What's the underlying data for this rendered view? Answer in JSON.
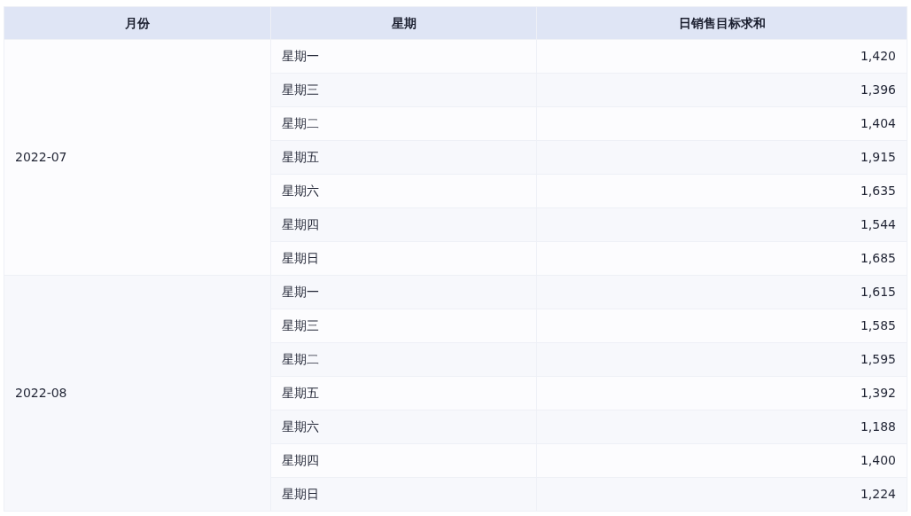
{
  "table": {
    "columns": [
      "月份",
      "星期",
      "日销售目标求和"
    ],
    "groups": [
      {
        "month": "2022-07",
        "rows": [
          {
            "weekday": "星期一",
            "value": "1,420"
          },
          {
            "weekday": "星期三",
            "value": "1,396"
          },
          {
            "weekday": "星期二",
            "value": "1,404"
          },
          {
            "weekday": "星期五",
            "value": "1,915"
          },
          {
            "weekday": "星期六",
            "value": "1,635"
          },
          {
            "weekday": "星期四",
            "value": "1,544"
          },
          {
            "weekday": "星期日",
            "value": "1,685"
          }
        ]
      },
      {
        "month": "2022-08",
        "rows": [
          {
            "weekday": "星期一",
            "value": "1,615"
          },
          {
            "weekday": "星期三",
            "value": "1,585"
          },
          {
            "weekday": "星期二",
            "value": "1,595"
          },
          {
            "weekday": "星期五",
            "value": "1,392"
          },
          {
            "weekday": "星期六",
            "value": "1,188"
          },
          {
            "weekday": "星期四",
            "value": "1,400"
          },
          {
            "weekday": "星期日",
            "value": "1,224"
          }
        ]
      }
    ]
  }
}
